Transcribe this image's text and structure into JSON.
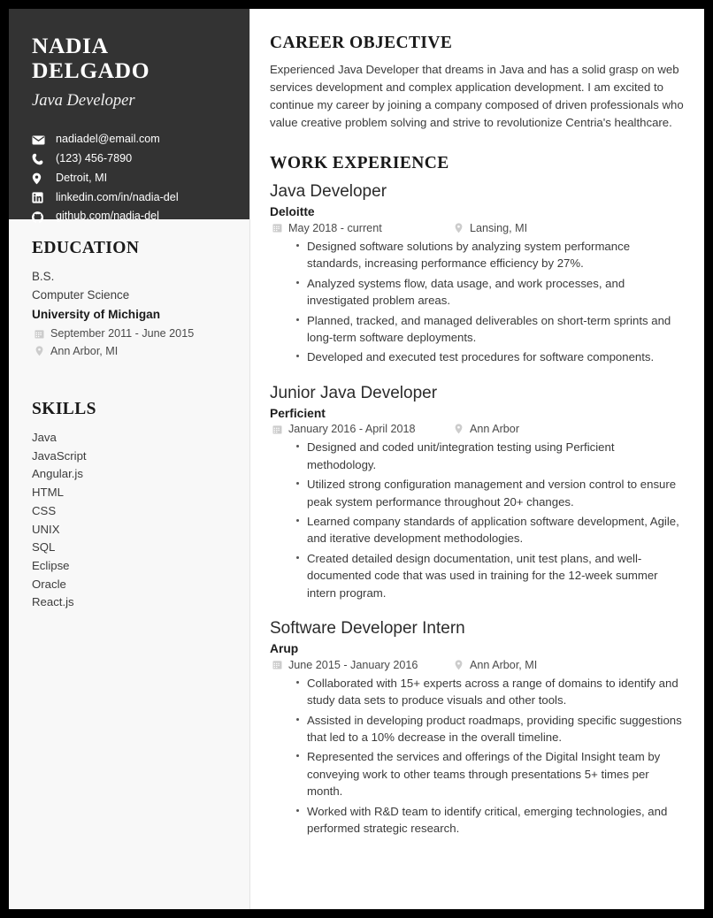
{
  "profile": {
    "name": "NADIA DELGADO",
    "headline": "Java Developer",
    "contacts": [
      {
        "icon": "envelope-icon",
        "text": "nadiadel@email.com"
      },
      {
        "icon": "phone-icon",
        "text": "(123) 456-7890"
      },
      {
        "icon": "map-pin-icon",
        "text": "Detroit, MI"
      },
      {
        "icon": "linkedin-icon",
        "text": "linkedin.com/in/nadia-del"
      },
      {
        "icon": "github-icon",
        "text": "github.com/nadia-del"
      }
    ]
  },
  "education": {
    "heading": "EDUCATION",
    "degree": "B.S.",
    "field": "Computer Science",
    "school": "University of Michigan",
    "dates": "September 2011 - June 2015",
    "location": "Ann Arbor, MI"
  },
  "skills": {
    "heading": "SKILLS",
    "items": [
      "Java",
      "JavaScript",
      "Angular.js",
      "HTML",
      "CSS",
      "UNIX",
      "SQL",
      "Eclipse",
      "Oracle",
      "React.js"
    ]
  },
  "objective": {
    "heading": "CAREER OBJECTIVE",
    "text": "Experienced Java Developer that dreams in Java and has a solid grasp on web services development and complex application development. I am excited to continue my career by joining a company composed of driven professionals who value creative problem solving and strive to revolutionize Centria's healthcare."
  },
  "work": {
    "heading": "WORK EXPERIENCE",
    "jobs": [
      {
        "title": "Java Developer",
        "company": "Deloitte",
        "dates": "May 2018 - current",
        "location": "Lansing, MI",
        "bullets": [
          "Designed software solutions by analyzing system performance standards, increasing performance efficiency by 27%.",
          "Analyzed systems flow, data usage, and work processes, and investigated problem areas.",
          "Planned, tracked, and managed deliverables on short-term sprints and long-term software deployments.",
          "Developed and executed test procedures for software components."
        ]
      },
      {
        "title": "Junior Java Developer",
        "company": "Perficient",
        "dates": "January 2016 - April 2018",
        "location": "Ann Arbor",
        "bullets": [
          "Designed and coded unit/integration testing using Perficient methodology.",
          "Utilized strong configuration management and version control to ensure peak system performance throughout 20+ changes.",
          "Learned company standards of application software development, Agile, and iterative development methodologies.",
          "Created detailed design documentation, unit test plans, and well-documented code that was used in training for the 12-week summer intern program."
        ]
      },
      {
        "title": "Software Developer Intern",
        "company": "Arup",
        "dates": "June 2015 - January 2016",
        "location": "Ann Arbor, MI",
        "bullets": [
          "Collaborated with 15+ experts across a range of domains to identify and study data sets to produce visuals and other tools.",
          "Assisted in developing product roadmaps, providing specific suggestions that led to a 10% decrease in the overall timeline.",
          "Represented the services and offerings of the Digital Insight team by conveying work to other teams through presentations 5+ times per month.",
          "Worked with R&D team to identify critical, emerging technologies, and performed strategic research."
        ]
      }
    ]
  },
  "theme": {
    "header_bg": "#333333",
    "sidebar_bg": "#f8f8f8",
    "page_border": "#000000",
    "text_dark": "#1a1a1a",
    "text_body": "#3a3a3a",
    "icon_gray": "#c9c9c9"
  }
}
